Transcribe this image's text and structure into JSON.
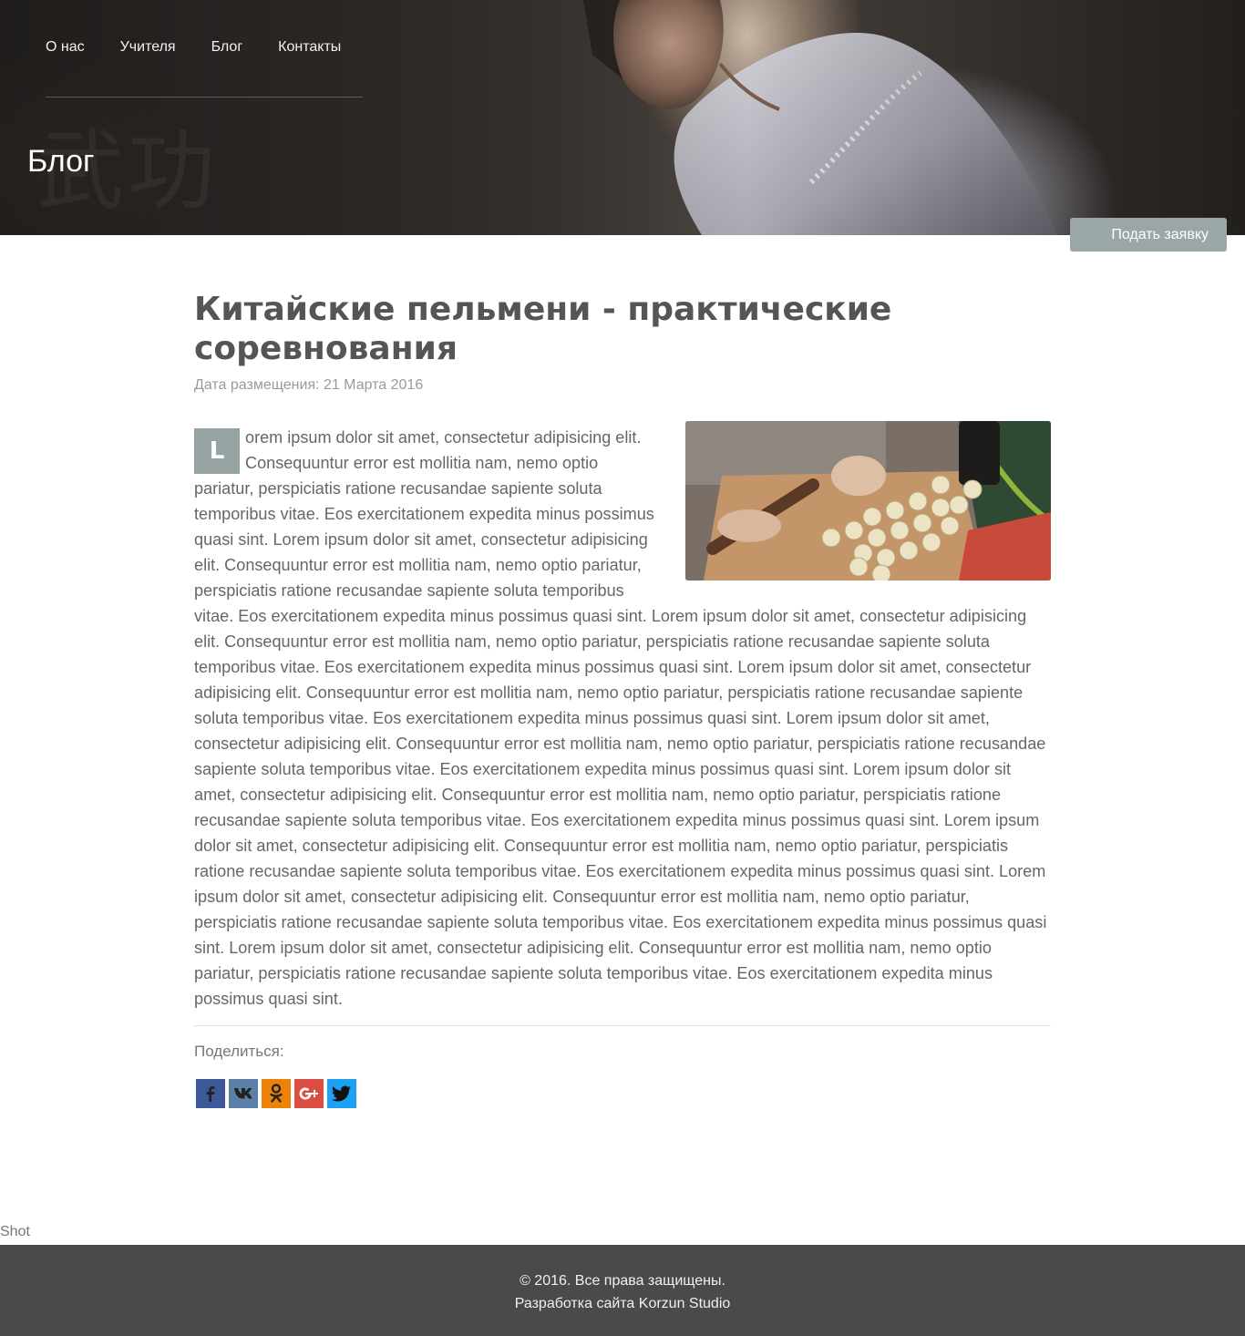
{
  "nav": {
    "items": [
      "О нас",
      "Учителя",
      "Блог",
      "Контакты"
    ]
  },
  "hero": {
    "title": "Блог",
    "hanzi": "武功",
    "request_button": "Подать заявку"
  },
  "article": {
    "title": "Китайские пельмени - практические соревнования",
    "date": "Дата размещения: 21 Марта 2016",
    "dropcap": "L",
    "text": "orem ipsum dolor sit amet, consectetur adipisicing elit. Consequuntur error est mollitia nam, nemo optio pariatur, perspiciatis ratione recusandae sapiente soluta temporibus vitae. Eos exercitationem expedita minus possimus quasi sint. Lorem ipsum dolor sit amet, consectetur adipisicing elit. Consequuntur error est mollitia nam, nemo optio pariatur, perspiciatis ratione recusandae sapiente soluta temporibus vitae. Eos exercitationem expedita minus possimus quasi sint. Lorem ipsum dolor sit amet, consectetur adipisicing elit. Consequuntur error est mollitia nam, nemo optio pariatur, perspiciatis ratione recusandae sapiente soluta temporibus vitae. Eos exercitationem expedita minus possimus quasi sint. Lorem ipsum dolor sit amet, consectetur adipisicing elit. Consequuntur error est mollitia nam, nemo optio pariatur, perspiciatis ratione recusandae sapiente soluta temporibus vitae. Eos exercitationem expedita minus possimus quasi sint. Lorem ipsum dolor sit amet, consectetur adipisicing elit. Consequuntur error est mollitia nam, nemo optio pariatur, perspiciatis ratione recusandae sapiente soluta temporibus vitae. Eos exercitationem expedita minus possimus quasi sint. Lorem ipsum dolor sit amet, consectetur adipisicing elit. Consequuntur error est mollitia nam, nemo optio pariatur, perspiciatis ratione recusandae sapiente soluta temporibus vitae. Eos exercitationem expedita minus possimus quasi sint. Lorem ipsum dolor sit amet, consectetur adipisicing elit. Consequuntur error est mollitia nam, nemo optio pariatur, perspiciatis ratione recusandae sapiente soluta temporibus vitae. Eos exercitationem expedita minus possimus quasi sint. Lorem ipsum dolor sit amet, consectetur adipisicing elit. Consequuntur error est mollitia nam, nemo optio pariatur, perspiciatis ratione recusandae sapiente soluta temporibus vitae. Eos exercitationem expedita minus possimus quasi sint. Lorem ipsum dolor sit amet, consectetur adipisicing elit. Consequuntur error est mollitia nam, nemo optio pariatur, perspiciatis ratione recusandae sapiente soluta temporibus vitae. Eos exercitationem expedita minus possimus quasi sint.",
    "share_label": "Поделиться:"
  },
  "share_buttons": [
    {
      "name": "facebook",
      "icon": "facebook-icon",
      "color": "#3b5998"
    },
    {
      "name": "vk",
      "icon": "vk-icon",
      "color": "#5b7fa6"
    },
    {
      "name": "odnoklassniki",
      "icon": "odnoklassniki-icon",
      "color": "#ee8208"
    },
    {
      "name": "google-plus",
      "icon": "google-plus-icon",
      "color": "#dc4e41"
    },
    {
      "name": "twitter",
      "icon": "twitter-icon",
      "color": "#1da1f2"
    }
  ],
  "shot_label": "Shot",
  "footer": {
    "copyright": "© 2016. Все права защищены.",
    "credit": "Разработка сайта Korzun Studio"
  },
  "colors": {
    "accent": "#95a3a2",
    "footer_bg": "#4a4a4c"
  }
}
